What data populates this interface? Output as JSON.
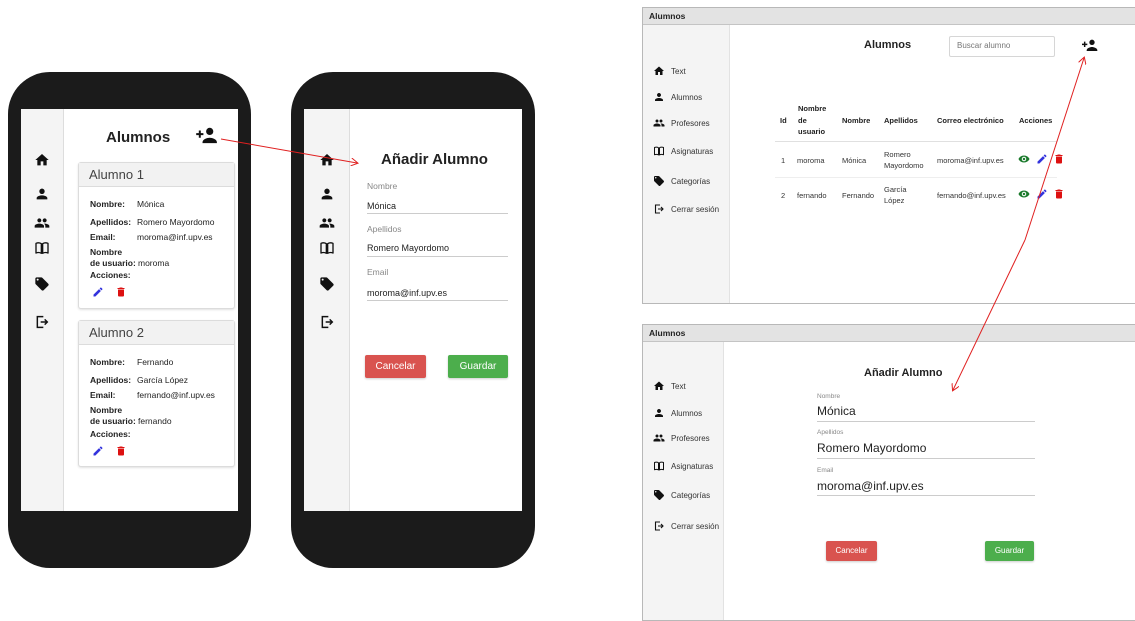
{
  "mobile_list": {
    "title": "Alumnos",
    "students": [
      {
        "header": "Alumno 1",
        "nombre_label": "Nombre:",
        "nombre": "Mónica",
        "apellidos_label": "Apellidos:",
        "apellidos": "Romero Mayordomo",
        "email_label": "Email:",
        "email": "moroma@inf.upv.es",
        "usuario_label_1": "Nombre",
        "usuario_label_2": "de usuario:",
        "usuario": "moroma",
        "acciones_label": "Acciones:"
      },
      {
        "header": "Alumno 2",
        "nombre_label": "Nombre:",
        "nombre": "Fernando",
        "apellidos_label": "Apellidos:",
        "apellidos": "García López",
        "email_label": "Email:",
        "email": "fernando@inf.upv.es",
        "usuario_label_1": "Nombre",
        "usuario_label_2": "de usuario:",
        "usuario": "fernando",
        "acciones_label": "Acciones:"
      }
    ]
  },
  "mobile_add": {
    "title": "Añadir Alumno",
    "fields": [
      {
        "label": "Nombre",
        "value": "Mónica"
      },
      {
        "label": "Apellidos",
        "value": "Romero Mayordomo"
      },
      {
        "label": "Email",
        "value": "moroma@inf.upv.es"
      }
    ],
    "cancel_label": "Cancelar",
    "save_label": "Guardar"
  },
  "desktop_list": {
    "window_title": "Alumnos",
    "title": "Alumnos",
    "search_placeholder": "Buscar alumno",
    "nav": [
      "Text",
      "Alumnos",
      "Profesores",
      "Asignaturas",
      "Categorías",
      "Cerrar sesión"
    ],
    "columns": {
      "id": "Id",
      "usuario_1": "Nombre",
      "usuario_2": "de",
      "usuario_3": "usuario",
      "nombre": "Nombre",
      "apellidos": "Apellidos",
      "correo": "Correo electrónico",
      "acciones": "Acciones"
    },
    "rows": [
      {
        "id": "1",
        "usuario": "moroma",
        "nombre": "Mónica",
        "apellidos_1": "Romero",
        "apellidos_2": "Mayordomo",
        "correo": "moroma@inf.upv.es"
      },
      {
        "id": "2",
        "usuario": "fernando",
        "nombre": "Fernando",
        "apellidos_1": "García",
        "apellidos_2": "López",
        "correo": "fernando@inf.upv.es"
      }
    ]
  },
  "desktop_add": {
    "window_title": "Alumnos",
    "title": "Añadir Alumno",
    "nav": [
      "Text",
      "Alumnos",
      "Profesores",
      "Asignaturas",
      "Categorías",
      "Cerrar sesión"
    ],
    "fields": [
      {
        "label": "Nombre",
        "value": "Mónica"
      },
      {
        "label": "Apellidos",
        "value": "Romero Mayordomo"
      },
      {
        "label": "Email",
        "value": "moroma@inf.upv.es"
      }
    ],
    "cancel_label": "Cancelar",
    "save_label": "Guardar"
  },
  "colors": {
    "edit": "#3333dd",
    "delete": "#dd1111",
    "view": "#1b7a2c",
    "cancel": "#d9534f",
    "save": "#4cae4c",
    "arrow": "#e02020"
  }
}
